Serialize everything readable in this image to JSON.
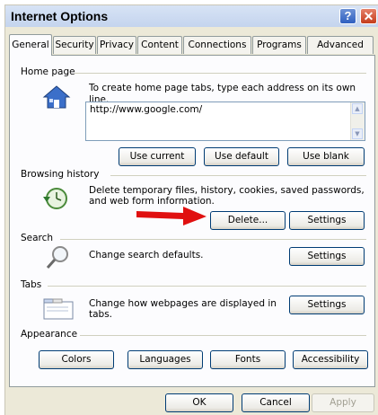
{
  "window": {
    "title": "Internet Options"
  },
  "titlebar_buttons": {
    "help": "?",
    "close": "✕"
  },
  "tabs": [
    "General",
    "Security",
    "Privacy",
    "Content",
    "Connections",
    "Programs",
    "Advanced"
  ],
  "home_page": {
    "heading": "Home page",
    "description": "To create home page tabs, type each address on its own line.",
    "url": "http://www.google.com/",
    "buttons": {
      "use_current": "Use current",
      "use_default": "Use default",
      "use_blank": "Use blank"
    },
    "icon": "house-icon"
  },
  "browsing_history": {
    "heading": "Browsing history",
    "description_line1": "Delete temporary files, history, cookies, saved passwords,",
    "description_line2": "and web form information.",
    "buttons": {
      "delete": "Delete...",
      "settings": "Settings"
    },
    "icon": "history-clock-icon"
  },
  "search": {
    "heading": "Search",
    "description": "Change search defaults.",
    "buttons": {
      "settings": "Settings"
    },
    "icon": "magnifier-icon"
  },
  "tabs_section": {
    "heading": "Tabs",
    "description_line1": "Change how webpages are displayed in",
    "description_line2": "tabs.",
    "buttons": {
      "settings": "Settings"
    },
    "icon": "tabbed-window-icon"
  },
  "appearance": {
    "heading": "Appearance",
    "buttons": {
      "colors": "Colors",
      "languages": "Languages",
      "fonts": "Fonts",
      "accessibility": "Accessibility"
    }
  },
  "footer": {
    "ok": "OK",
    "cancel": "Cancel",
    "apply": "Apply"
  },
  "colors": {
    "annotation_arrow": "#e01010",
    "title_bar": "#c4d4ee",
    "dialog_bg": "#ece9d8"
  }
}
